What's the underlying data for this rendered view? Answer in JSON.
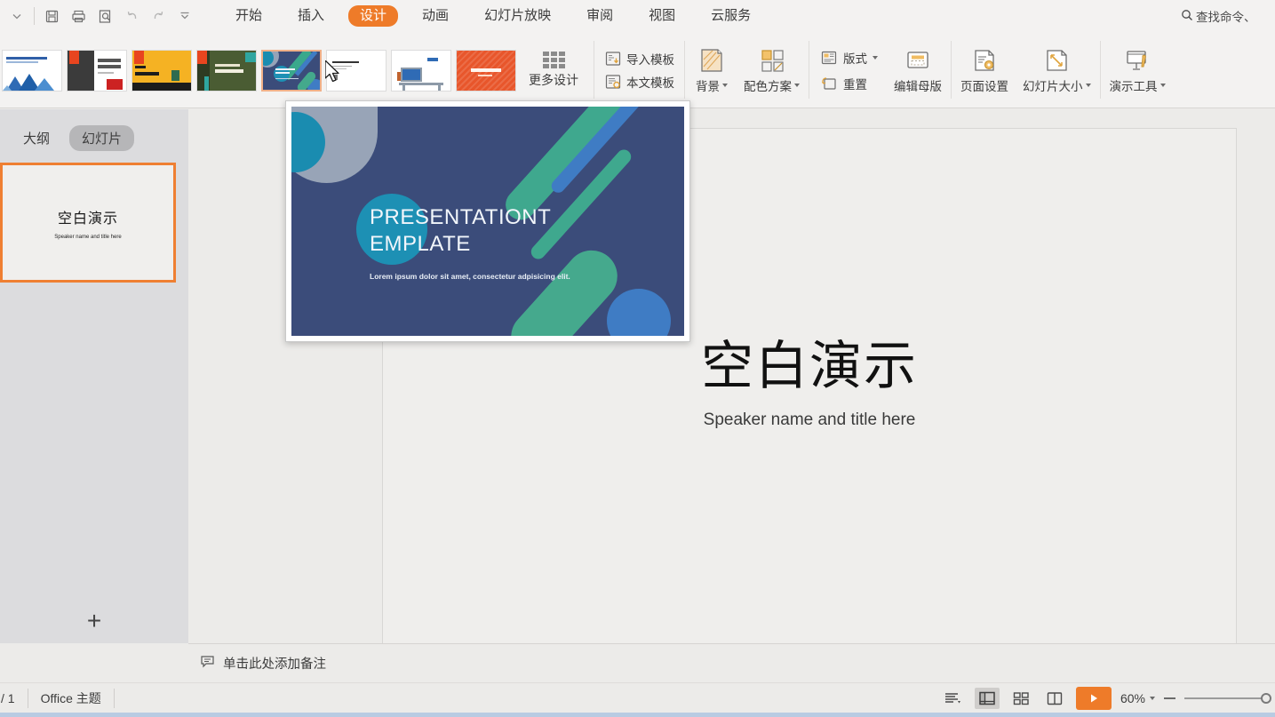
{
  "app": {
    "quick_access": [
      {
        "name": "dropdown-caret-icon",
        "label": "⌄"
      },
      {
        "name": "save-icon",
        "label": "Save"
      },
      {
        "name": "print-icon",
        "label": "Print"
      },
      {
        "name": "print-preview-icon",
        "label": "Print Preview"
      },
      {
        "name": "undo-icon",
        "label": "Undo"
      },
      {
        "name": "redo-icon",
        "label": "Redo"
      },
      {
        "name": "customize-icon",
        "label": "Customize"
      }
    ],
    "tabs": [
      {
        "label": "开始",
        "active": false
      },
      {
        "label": "插入",
        "active": false
      },
      {
        "label": "设计",
        "active": true
      },
      {
        "label": "动画",
        "active": false
      },
      {
        "label": "幻灯片放映",
        "active": false
      },
      {
        "label": "审阅",
        "active": false
      },
      {
        "label": "视图",
        "active": false
      },
      {
        "label": "云服务",
        "active": false
      }
    ],
    "search": {
      "text": "查找命令、",
      "icon": "search-icon"
    },
    "accent_color": "#ee7b29"
  },
  "ribbon": {
    "gallery": {
      "thumbnails": [
        {
          "name": "template-mountain-blue",
          "selected": false
        },
        {
          "name": "template-company-introduction",
          "selected": false
        },
        {
          "name": "template-business-plan-2018",
          "selected": false
        },
        {
          "name": "template-brand-appreciation",
          "selected": false
        },
        {
          "name": "template-presentation-blue",
          "selected": true
        },
        {
          "name": "template-text-document",
          "selected": false
        },
        {
          "name": "template-desk-illustration",
          "selected": false
        },
        {
          "name": "template-orange-gratitude",
          "selected": false
        }
      ],
      "more_label": "更多设计"
    },
    "template_group": {
      "import_label": "导入模板",
      "text_template_label": "本文模板"
    },
    "design_group": {
      "background_label": "背景",
      "color_scheme_label": "配色方案"
    },
    "layout_group": {
      "layout_label": "版式",
      "reset_label": "重置",
      "edit_master_label": "编辑母版"
    },
    "page_group": {
      "page_setup_label": "页面设置",
      "slide_size_label": "幻灯片大小"
    },
    "tools_group": {
      "presentation_tools_label": "演示工具"
    }
  },
  "sidebar": {
    "tabs": [
      {
        "label": "大纲",
        "active": false
      },
      {
        "label": "幻灯片",
        "active": true
      }
    ],
    "slide_thumb": {
      "title": "空白演示",
      "subtitle": "Speaker name and title here"
    },
    "add_slide_label": "+"
  },
  "slide": {
    "title": "空白演示",
    "subtitle": "Speaker name and title here"
  },
  "preview": {
    "title_line1": "PRESENTATIONT",
    "title_line2": "EMPLATE",
    "subtitle": "Lorem ipsum dolor sit amet, consectetur adpisicing elit.",
    "bg_color": "#3b4c7a"
  },
  "notes": {
    "icon": "note-icon",
    "placeholder": "单击此处添加备注"
  },
  "status": {
    "page_indicator": "/ 1",
    "theme": "Office 主题",
    "views": [
      {
        "name": "view-options-icon",
        "active": false
      },
      {
        "name": "normal-view-icon",
        "active": true
      },
      {
        "name": "slide-sorter-icon",
        "active": false
      },
      {
        "name": "reading-view-icon",
        "active": false
      }
    ],
    "play_label": "▶",
    "zoom_level": "60%"
  }
}
